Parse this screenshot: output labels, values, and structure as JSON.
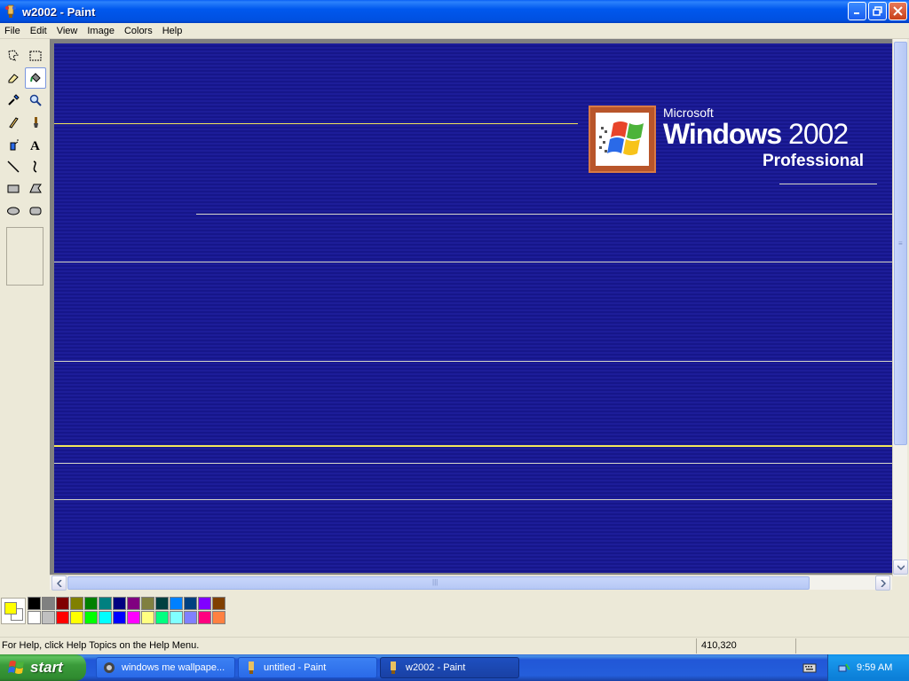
{
  "window": {
    "title": "w2002 - Paint"
  },
  "menu": {
    "items": [
      "File",
      "Edit",
      "View",
      "Image",
      "Colors",
      "Help"
    ]
  },
  "tools": [
    {
      "name": "free-form-select-icon"
    },
    {
      "name": "select-icon"
    },
    {
      "name": "eraser-icon"
    },
    {
      "name": "fill-with-color-icon"
    },
    {
      "name": "pick-color-icon"
    },
    {
      "name": "magnifier-icon"
    },
    {
      "name": "pencil-icon"
    },
    {
      "name": "brush-icon"
    },
    {
      "name": "airbrush-icon"
    },
    {
      "name": "text-icon"
    },
    {
      "name": "line-icon"
    },
    {
      "name": "curve-icon"
    },
    {
      "name": "rectangle-icon"
    },
    {
      "name": "polygon-icon"
    },
    {
      "name": "ellipse-icon"
    },
    {
      "name": "rounded-rectangle-icon"
    }
  ],
  "active_tool": "fill-with-color-icon",
  "canvas": {
    "logo_microsoft": "Microsoft",
    "logo_windows": "Windows",
    "logo_version": "2002",
    "logo_edition": "Professional"
  },
  "palette": {
    "foreground": "#ffff00",
    "background": "#ffffff",
    "row1": [
      "#000000",
      "#808080",
      "#800000",
      "#808000",
      "#008000",
      "#008080",
      "#000080",
      "#800080",
      "#808040",
      "#004040",
      "#0080ff",
      "#004080",
      "#8000ff",
      "#804000"
    ],
    "row2": [
      "#ffffff",
      "#c0c0c0",
      "#ff0000",
      "#ffff00",
      "#00ff00",
      "#00ffff",
      "#0000ff",
      "#ff00ff",
      "#ffff80",
      "#00ff80",
      "#80ffff",
      "#8080ff",
      "#ff0080",
      "#ff8040"
    ]
  },
  "status": {
    "help": "For Help, click Help Topics on the Help Menu.",
    "coords": "410,320"
  },
  "taskbar": {
    "start": "start",
    "tasks": [
      {
        "label": "windows me wallpape...",
        "active": false
      },
      {
        "label": "untitled - Paint",
        "active": false
      },
      {
        "label": "w2002 - Paint",
        "active": true
      }
    ],
    "clock": "9:59 AM"
  }
}
